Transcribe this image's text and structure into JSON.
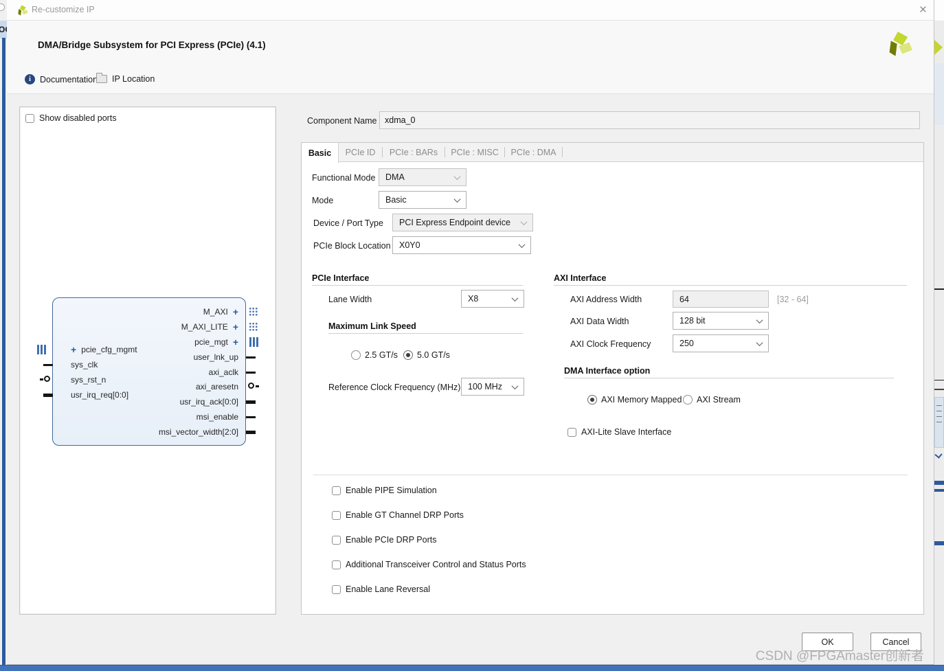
{
  "titlebar": {
    "title": "Re-customize IP"
  },
  "icons": {
    "close": "×",
    "plus": "+",
    "info": "i"
  },
  "header": {
    "title": "DMA/Bridge Subsystem for PCI Express (PCIe) (4.1)"
  },
  "toolbar": {
    "documentation": "Documentation",
    "ip_location": "IP Location"
  },
  "diagram": {
    "show_disabled_ports": "Show disabled ports",
    "left_ports": [
      {
        "name": "pcie_cfg_mgmt"
      },
      {
        "name": "sys_clk"
      },
      {
        "name": "sys_rst_n"
      },
      {
        "name": "usr_irq_req[0:0]"
      }
    ],
    "right_ports": [
      {
        "name": "M_AXI"
      },
      {
        "name": "M_AXI_LITE"
      },
      {
        "name": "pcie_mgt"
      },
      {
        "name": "user_lnk_up"
      },
      {
        "name": "axi_aclk"
      },
      {
        "name": "axi_aresetn"
      },
      {
        "name": "usr_irq_ack[0:0]"
      },
      {
        "name": "msi_enable"
      },
      {
        "name": "msi_vector_width[2:0]"
      }
    ]
  },
  "component_name": {
    "label": "Component Name",
    "value": "xdma_0"
  },
  "tabs": [
    {
      "label": "Basic"
    },
    {
      "label": "PCIe ID"
    },
    {
      "label": "PCIe : BARs"
    },
    {
      "label": "PCIe : MISC"
    },
    {
      "label": "PCIe : DMA"
    }
  ],
  "basic": {
    "functional_mode": {
      "label": "Functional Mode",
      "value": "DMA"
    },
    "mode": {
      "label": "Mode",
      "value": "Basic"
    },
    "device_port_type": {
      "label": "Device / Port Type",
      "value": "PCI Express Endpoint device"
    },
    "pcie_block_location": {
      "label": "PCIe Block Location",
      "value": "X0Y0"
    },
    "pcie_interface": {
      "title": "PCIe Interface",
      "lane_width": {
        "label": "Lane Width",
        "value": "X8"
      },
      "max_link_speed": {
        "title": "Maximum Link Speed",
        "options": [
          "2.5 GT/s",
          "5.0 GT/s"
        ],
        "selected": "5.0 GT/s"
      },
      "ref_clock": {
        "label": "Reference Clock Frequency (MHz)",
        "value": "100 MHz"
      }
    },
    "axi_interface": {
      "title": "AXI Interface",
      "address_width": {
        "label": "AXI Address Width",
        "value": "64",
        "hint": "[32 - 64]"
      },
      "data_width": {
        "label": "AXI Data Width",
        "value": "128 bit"
      },
      "clock_frequency": {
        "label": "AXI Clock Frequency",
        "value": "250"
      },
      "dma_option": {
        "title": "DMA Interface option",
        "options": [
          "AXI Memory Mapped",
          "AXI Stream"
        ],
        "selected": "AXI Memory Mapped"
      },
      "axi_lite": {
        "label": "AXI-Lite Slave Interface",
        "checked": false
      }
    },
    "checkboxes": [
      {
        "label": "Enable PIPE Simulation",
        "checked": false
      },
      {
        "label": "Enable GT Channel DRP Ports",
        "checked": false
      },
      {
        "label": "Enable PCIe DRP Ports",
        "checked": false
      },
      {
        "label": "Additional Transceiver Control and Status Ports",
        "checked": false
      },
      {
        "label": "Enable Lane Reversal",
        "checked": false
      }
    ]
  },
  "footer": {
    "ok": "OK",
    "cancel": "Cancel"
  },
  "watermark": "CSDN @FPGAmaster创新者",
  "background": {
    "left_fragment_text": "OC"
  },
  "colors": {
    "accent_blue": "#1f5fa6",
    "block_border": "#41699c",
    "block_fill": "#eef3fa",
    "taskbar_blue": "#4372bd",
    "sidebar_blue": "#2d5a9c",
    "info_icon_blue": "#27477f"
  }
}
